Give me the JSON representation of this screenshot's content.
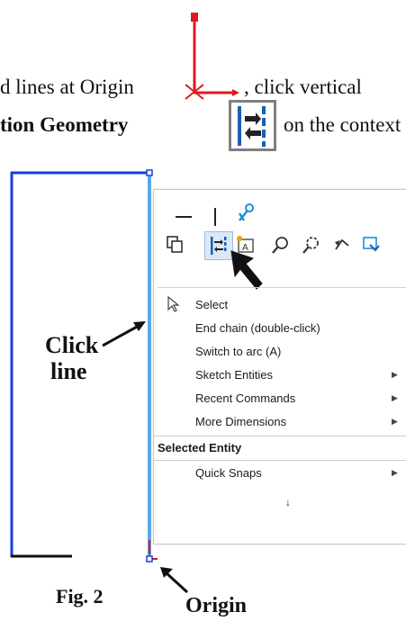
{
  "text": {
    "line1_prefix": "d lines at Origin",
    "line1_suffix": ", click vertical",
    "line2_bold": "tion Geometry",
    "line2_suffix": "on the context"
  },
  "callouts": {
    "click_line_1": "Click",
    "click_line_2": "line",
    "origin": "Origin",
    "figure": "Fig. 2"
  },
  "context_menu": {
    "items": [
      {
        "label": "Select",
        "has_submenu": false
      },
      {
        "label": "End chain  (double-click)",
        "has_submenu": false
      },
      {
        "label": "Switch to arc  (A)",
        "has_submenu": false
      },
      {
        "label": "Sketch Entities",
        "has_submenu": true
      },
      {
        "label": "Recent Commands",
        "has_submenu": true
      },
      {
        "label": "More Dimensions",
        "has_submenu": true
      }
    ],
    "section_header": "Selected Entity",
    "section_items": [
      {
        "label": "Quick Snaps",
        "has_submenu": true
      }
    ],
    "expand_icon": "double-chevron-down"
  },
  "colors": {
    "sketch_blue": "#1a3fd6",
    "selected_line": "#5aa9e6",
    "origin_red": "#e0191e",
    "menu_border": "#c9c9c9"
  }
}
